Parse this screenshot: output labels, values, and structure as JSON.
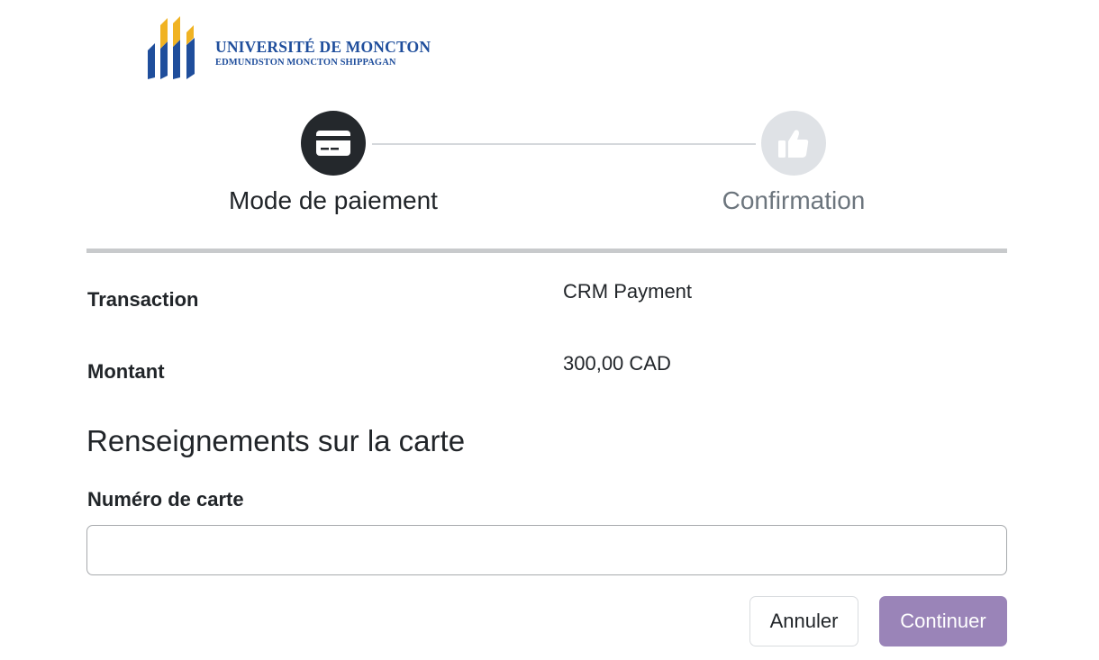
{
  "logo": {
    "name": "UNIVERSITÉ DE MONCTON",
    "campuses": "EDMUNDSTON  MONCTON  SHIPPAGAN",
    "colors": {
      "blue": "#1f4e9c",
      "gold": "#f0b323"
    }
  },
  "stepper": {
    "steps": [
      {
        "label": "Mode de paiement",
        "icon": "credit-card-icon",
        "state": "active"
      },
      {
        "label": "Confirmation",
        "icon": "thumbs-up-icon",
        "state": "inactive"
      }
    ]
  },
  "summary": {
    "transaction_label": "Transaction",
    "transaction_value": "CRM Payment",
    "amount_label": "Montant",
    "amount_value": "300,00 CAD"
  },
  "card_section": {
    "title": "Renseignements sur la carte",
    "card_number_label": "Numéro de carte",
    "card_number_value": "",
    "card_number_placeholder": ""
  },
  "actions": {
    "cancel_label": "Annuler",
    "continue_label": "Continuer"
  },
  "colors": {
    "active_step": "#24282c",
    "inactive_step": "#dfe2e6",
    "continue_button": "#9a84b8"
  }
}
